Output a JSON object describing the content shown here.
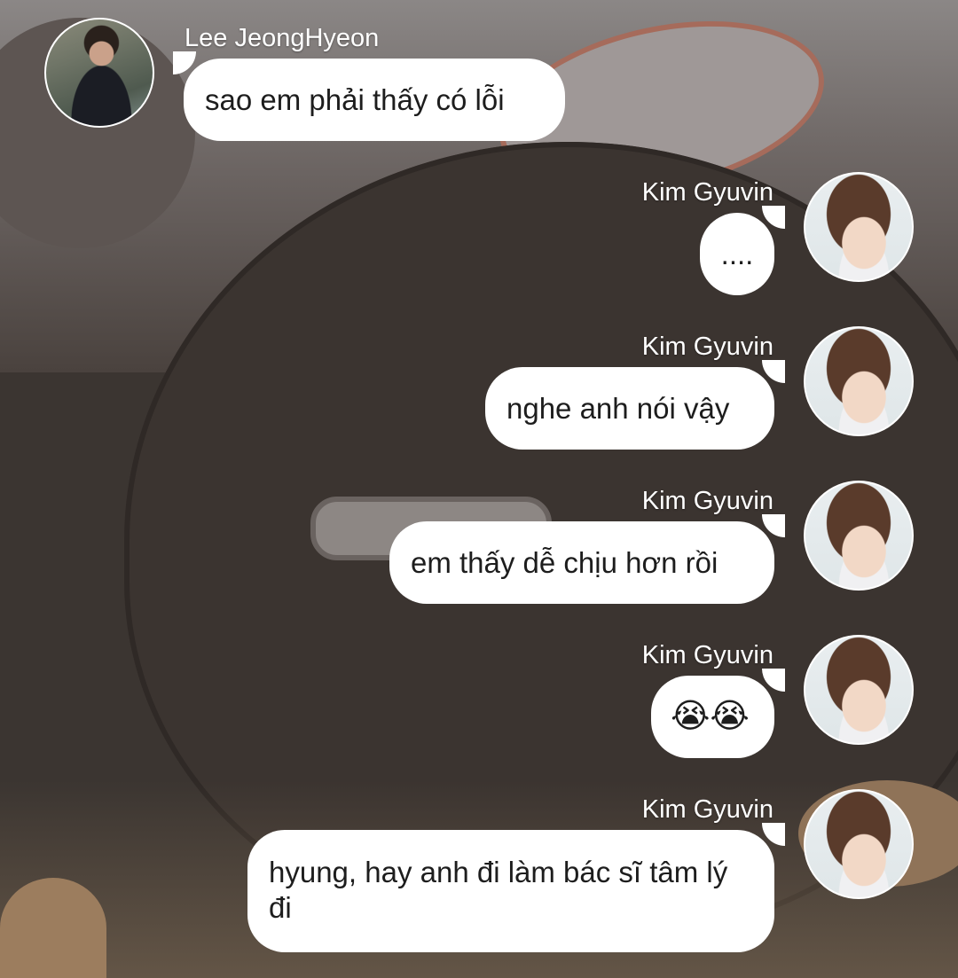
{
  "messages": [
    {
      "sender": "Lee JeongHyeon",
      "text": "sao em phải thấy có lỗi",
      "side": "left"
    },
    {
      "sender": "Kim Gyuvin",
      "text": "....",
      "side": "right"
    },
    {
      "sender": "Kim Gyuvin",
      "text": "nghe anh nói vậy",
      "side": "right"
    },
    {
      "sender": "Kim Gyuvin",
      "text": "em thấy dễ chịu hơn rồi",
      "side": "right"
    },
    {
      "sender": "Kim Gyuvin",
      "text": "😭😭",
      "side": "right"
    },
    {
      "sender": "Kim Gyuvin",
      "text": "hyung, hay anh đi làm bác sĩ tâm lý đi",
      "side": "right"
    }
  ],
  "avatars": {
    "lee": "avatar-photo-lee-jeonghyeon",
    "kim": "avatar-photo-kim-gyuvin"
  },
  "colors": {
    "bubble": "#ffffff",
    "name_text": "#ffffff",
    "message_text": "#1d1d1d"
  }
}
